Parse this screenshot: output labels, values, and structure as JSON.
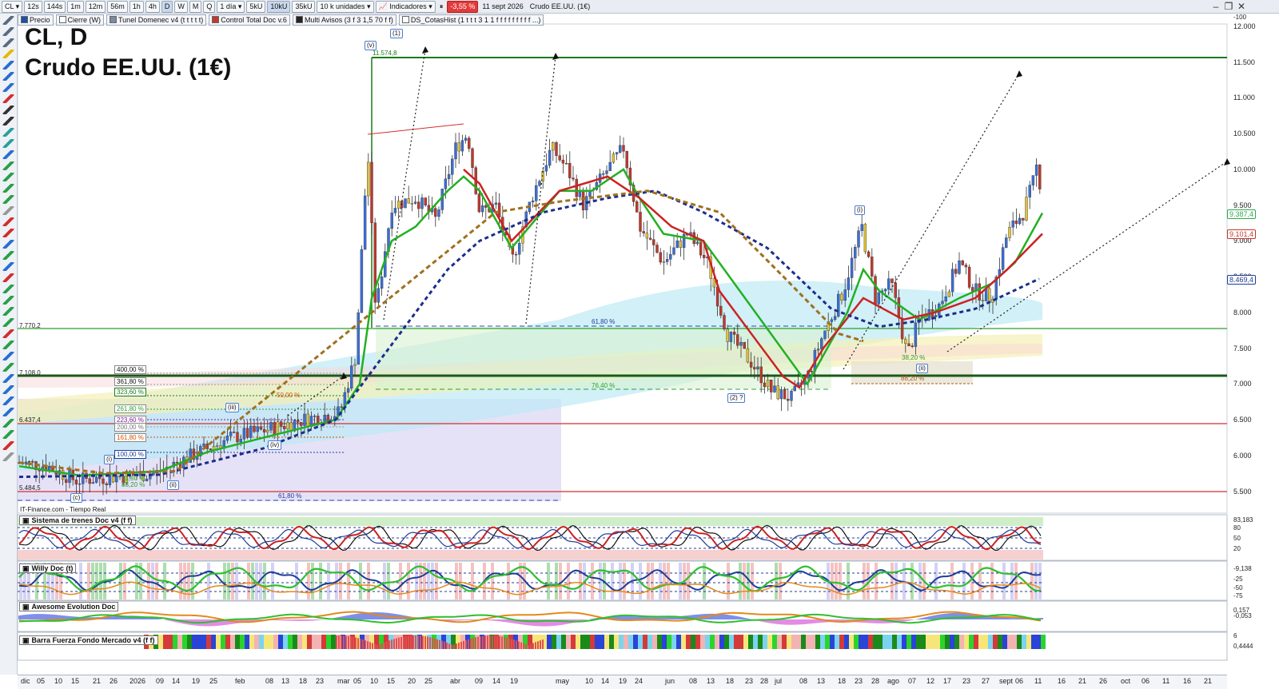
{
  "toolbar": {
    "symbol": "CL",
    "timeframes": [
      "12s",
      "144s",
      "1m",
      "12m",
      "56m",
      "1h",
      "4h",
      "D",
      "W",
      "M",
      "Q"
    ],
    "selected_timeframe": "D",
    "period": "1 día",
    "volume_buttons": [
      "5kU",
      "10kU",
      "35kU"
    ],
    "selected_volume": "10kU",
    "units": "10 k unidades",
    "indicators_label": "Indicadores",
    "change_badge": "-3,55 %",
    "date": "11 sept 2026",
    "instrument": "Crudo EE.UU. (1€)"
  },
  "indicator_legend": [
    {
      "label": "Precio",
      "color": "#1f4fa8"
    },
    {
      "label": "Cierre (W)",
      "color": "#ffffff"
    },
    {
      "label": "Tunel Domenec v4 (t t t t t)",
      "color": "#7a8aa0"
    },
    {
      "label": "Control Total Doc v.6",
      "color": "#c0392b"
    },
    {
      "label": "Multi Avisos (3 f 3 1,5 70 f f)",
      "color": "#222222"
    },
    {
      "label": "DS_CotasHist (1 t t t 3 1 1 f f f f f f f f f ...)",
      "color": "#ffffff"
    }
  ],
  "chart_title": {
    "line1": "CL, D",
    "line2": "Crudo EE.UU. (1€)"
  },
  "price_axis": [
    "12.000",
    "11.500",
    "11.000",
    "10.500",
    "10.000",
    "9.500",
    "9.000",
    "8.500",
    "8.000",
    "7.500",
    "7.000",
    "6.500",
    "6.000",
    "5.500"
  ],
  "price_tags": [
    {
      "label": "9.387,4",
      "color": "#2fa84f"
    },
    {
      "label": "9.101,4",
      "color": "#c0392b"
    },
    {
      "label": "8.469,4",
      "color": "#1f3c98"
    }
  ],
  "levels": [
    {
      "label": "11.574,8",
      "color": "#1a7a1a"
    },
    {
      "label": "7.770,2",
      "color": "#2e9e2e"
    },
    {
      "label": "7.108,0",
      "color": "#1a6a1a"
    },
    {
      "label": "6.437,4",
      "color": "#d32f2f"
    },
    {
      "label": "5.484,5",
      "color": "#d32f2f"
    }
  ],
  "fib_labels": [
    "400,00 %",
    "361,80 %",
    "323,60 %",
    "261,80 %",
    "223,60 %",
    "200,00 %",
    "161,80 %",
    "100,00 %",
    "61,80 %",
    "88,20 %",
    "61,80 %",
    "76,40 %",
    "61,80 %",
    "88,20 %",
    "50,00 %",
    "38,20 %"
  ],
  "wave_labels": [
    "(1)",
    "(v)",
    "(iii)",
    "(iv)",
    "(i)",
    "(ii)",
    "(c)",
    "(2) ?",
    "(i)",
    "(ii)"
  ],
  "source_note": "IT-Finance.com - Tiempo Real",
  "panes": [
    {
      "title": "Sistema de trenes Doc v4 (f f)",
      "axis": [
        "83,183",
        "80",
        "50",
        "20"
      ]
    },
    {
      "title": "Willy Doc (t)",
      "axis": [
        "-9,138",
        "-25",
        "-50",
        "-75",
        "-100"
      ]
    },
    {
      "title": "Awesome Evolution Doc",
      "axis": [
        "0,157",
        "-0,053"
      ]
    },
    {
      "title": "Barra Fuerza Fondo Mercado v4 (f f)",
      "axis": [
        "6",
        "0,4444"
      ]
    }
  ],
  "x_axis": [
    "dic",
    "05",
    "10",
    "15",
    "21",
    "26",
    "2026",
    "09",
    "14",
    "19",
    "25",
    "feb",
    "08",
    "13",
    "18",
    "23",
    "mar",
    "05",
    "10",
    "15",
    "20",
    "25",
    "abr",
    "09",
    "14",
    "19",
    "may",
    "10",
    "14",
    "19",
    "24",
    "jun",
    "08",
    "13",
    "18",
    "23",
    "28",
    "jul",
    "08",
    "13",
    "18",
    "23",
    "28",
    "ago",
    "07",
    "12",
    "17",
    "23",
    "27",
    "sept",
    "06",
    "11",
    "16",
    "21",
    "26",
    "oct",
    "06",
    "11",
    "16",
    "21"
  ],
  "colors": {
    "up": "#3a6fd8",
    "down": "#c0392b",
    "neutral": "#e0c33a",
    "green_line": "#22b022",
    "red_line": "#cc2222",
    "blue_dash": "#1c2e8c",
    "brown_dash": "#a0701e"
  }
}
